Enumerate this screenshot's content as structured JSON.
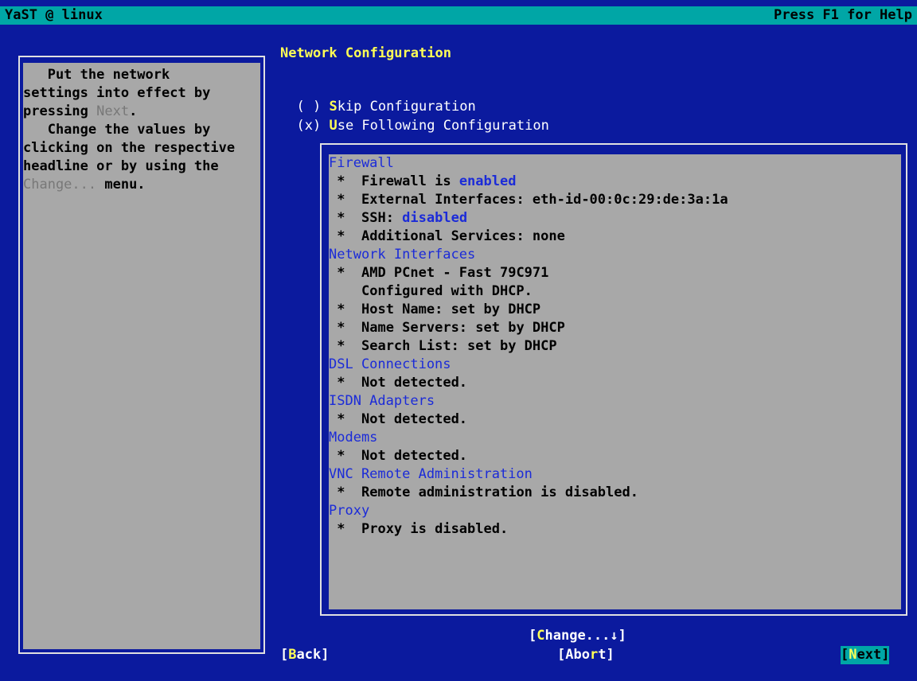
{
  "titlebar": {
    "left": "YaST @ linux",
    "right": "Press F1 for Help"
  },
  "help": {
    "lines": [
      [
        "   Put the network",
        ""
      ],
      [
        "settings into effect by",
        ""
      ],
      [
        "pressing ",
        "Next",
        "."
      ],
      [
        "   Change the values by",
        ""
      ],
      [
        "clicking on the respective",
        ""
      ],
      [
        "headline or by using the",
        ""
      ],
      [
        "",
        "Change...",
        " menu."
      ]
    ]
  },
  "heading": "Network Configuration",
  "radios": {
    "skip": {
      "mark": "( )",
      "hotkey": "S",
      "rest": "kip Configuration"
    },
    "use": {
      "mark": "(x)",
      "hotkey": "U",
      "rest": "se Following Configuration"
    }
  },
  "summary": [
    {
      "type": "section",
      "text": "Firewall"
    },
    {
      "type": "item",
      "text": "Firewall is ",
      "value": "enabled"
    },
    {
      "type": "item",
      "text": "External Interfaces: eth-id-00:0c:29:de:3a:1a"
    },
    {
      "type": "item",
      "text": "SSH: ",
      "value": "disabled"
    },
    {
      "type": "item",
      "text": "Additional Services: none"
    },
    {
      "type": "section",
      "text": "Network Interfaces"
    },
    {
      "type": "item",
      "text": "AMD PCnet - Fast 79C971"
    },
    {
      "type": "cont",
      "text": "Configured with DHCP."
    },
    {
      "type": "item",
      "text": "Host Name: set by DHCP"
    },
    {
      "type": "item",
      "text": "Name Servers: set by DHCP"
    },
    {
      "type": "item",
      "text": "Search List: set by DHCP"
    },
    {
      "type": "section",
      "text": "DSL Connections"
    },
    {
      "type": "item",
      "text": "Not detected."
    },
    {
      "type": "section",
      "text": "ISDN Adapters"
    },
    {
      "type": "item",
      "text": "Not detected."
    },
    {
      "type": "section",
      "text": "Modems"
    },
    {
      "type": "item",
      "text": "Not detected."
    },
    {
      "type": "section",
      "text": "VNC Remote Administration"
    },
    {
      "type": "item",
      "text": "Remote administration is disabled."
    },
    {
      "type": "section",
      "text": "Proxy"
    },
    {
      "type": "item",
      "text": "Proxy is disabled."
    }
  ],
  "buttons": {
    "change": {
      "open": "[",
      "hotkey": "C",
      "rest": "hange...↓]"
    },
    "back": {
      "open": "[",
      "hotkey": "B",
      "rest": "ack]"
    },
    "abort": {
      "open": "[",
      "pre": "Abo",
      "hotkey": "r",
      "rest": "t]"
    },
    "next": {
      "open": "[",
      "hotkey": "N",
      "rest": "ext]"
    }
  },
  "bullet": "*"
}
